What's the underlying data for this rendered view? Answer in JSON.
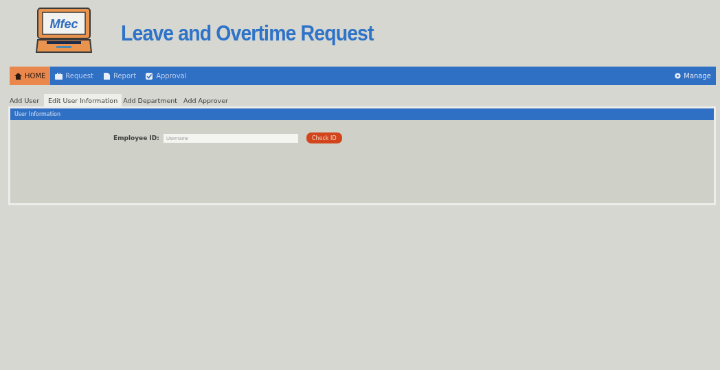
{
  "logo": {
    "text": "Mfec"
  },
  "header": {
    "title": "Leave and Overtime Request"
  },
  "nav": {
    "items": [
      {
        "label": "HOME",
        "kind": "home",
        "selected": true
      },
      {
        "label": "Request",
        "kind": "request",
        "selected": false
      },
      {
        "label": "Report",
        "kind": "report",
        "selected": false
      },
      {
        "label": "Approval",
        "kind": "approval",
        "selected": false
      }
    ],
    "manage": "Manage"
  },
  "tabs": [
    {
      "label": "Add User",
      "selected": false
    },
    {
      "label": "Edit User Information",
      "selected": true
    },
    {
      "label": "Add Department",
      "selected": false
    },
    {
      "label": "Add Approver",
      "selected": false
    }
  ],
  "panel": {
    "title": "User Information",
    "field_label": "Employee ID:",
    "placeholder": "Username",
    "button": "Check ID"
  }
}
